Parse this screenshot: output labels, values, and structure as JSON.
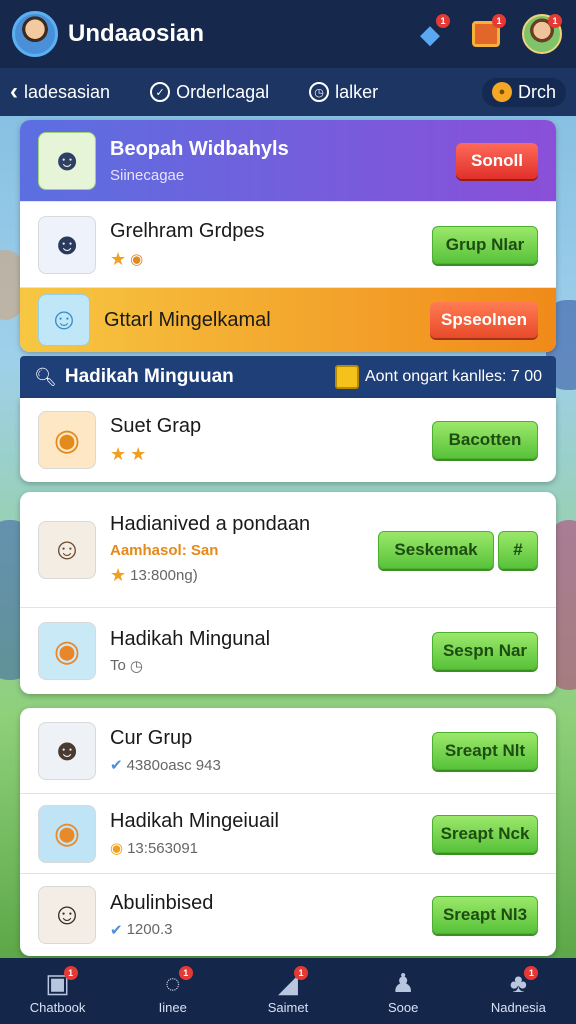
{
  "header": {
    "title": "Undaaosian",
    "icons": [
      "avatar",
      "bell-icon",
      "gift-icon",
      "profile-icon"
    ],
    "badges": {
      "notifications": "1",
      "gifts": "1",
      "profile": "1"
    }
  },
  "nav": {
    "back_label": "ladesasian",
    "item2_label": "Orderlcagal",
    "item3_label": "lalker",
    "coin_label": "Drch"
  },
  "top_card": {
    "featured": {
      "name": "Beopah Widbahyls",
      "subtitle": "Siinecagae",
      "button": "Sonoll"
    },
    "row1": {
      "name": "Grelhram Grdpes",
      "button": "Grup Nlar"
    },
    "highlight": {
      "name": "Gttarl Mingelkamal",
      "button": "Spseolnen"
    }
  },
  "section": {
    "title": "Hadikah Minguuan",
    "info": "Aont ongart kanlles: 7 00"
  },
  "list1": [
    {
      "name": "Suet Grap",
      "button": "Bacotten"
    }
  ],
  "list2": [
    {
      "name": "Hadianived a pondaan",
      "tag": "Aamhasol: San",
      "meta": "13:800ng)",
      "button": "Seskemak",
      "extra_btn": "#"
    },
    {
      "name": "Hadikah Mingunal",
      "meta": "To",
      "button": "Sespn Nar"
    }
  ],
  "list3": [
    {
      "name": "Cur Grup",
      "meta": "4380oasc 943",
      "button": "Sreapt Nlt"
    },
    {
      "name": "Hadikah Mingeiuail",
      "meta": "13:563091",
      "button": "Sreapt Nck"
    },
    {
      "name": "Abulinbised",
      "meta": "1200.3",
      "button": "Sreapt Nl3"
    }
  ],
  "tabs": [
    {
      "label": "Chatbook",
      "badge": "1"
    },
    {
      "label": "Iinee",
      "badge": "1"
    },
    {
      "label": "Saimet",
      "badge": "1"
    },
    {
      "label": "Sooe",
      "badge": ""
    },
    {
      "label": "Nadnesia",
      "badge": "1"
    }
  ],
  "colors": {
    "header_bg": "#16284c",
    "nav_bg": "#1d3563",
    "featured_gradient": [
      "#5b6fe0",
      "#8a4fd8"
    ],
    "highlight_gradient": [
      "#f5b93b",
      "#f08a1a"
    ],
    "green_button": "#58c23a",
    "red_button": "#e0302a"
  }
}
